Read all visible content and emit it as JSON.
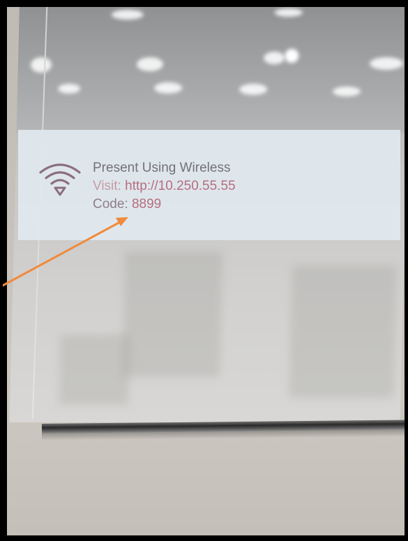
{
  "banner": {
    "title": "Present Using Wireless",
    "visit_label": "Visit:",
    "visit_url": "http://10.250.55.55",
    "code_label": "Code:",
    "code_value": "8899"
  },
  "icons": {
    "wireless": "wifi-icon"
  },
  "colors": {
    "banner_background": "#dfe8ee",
    "accent": "#b56e7e",
    "annotation_arrow": "#f08a3c"
  }
}
